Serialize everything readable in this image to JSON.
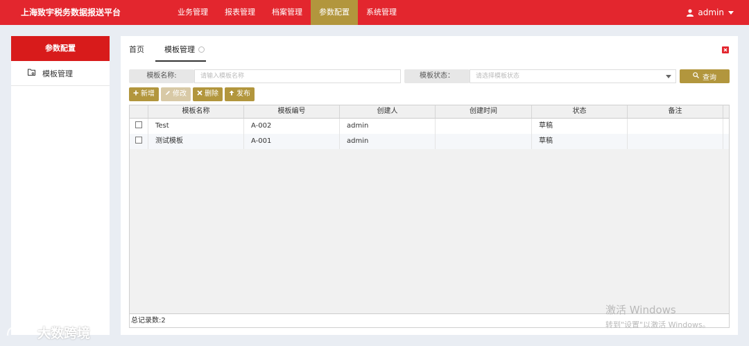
{
  "header": {
    "brand": "上海致宇税务数据报送平台",
    "nav": [
      "业务管理",
      "报表管理",
      "档案管理",
      "参数配置",
      "系统管理"
    ],
    "active_nav": "参数配置",
    "user": "admin"
  },
  "sidebar": {
    "title": "参数配置",
    "items": [
      {
        "label": "模板管理",
        "icon": "folder-icon"
      }
    ]
  },
  "tabs": [
    {
      "label": "首页"
    },
    {
      "label": "模板管理",
      "active": true
    }
  ],
  "search": {
    "name_label": "模板名称:",
    "name_placeholder": "请输入模板名称",
    "status_label": "模板状态：",
    "status_placeholder": "请选择模板状态",
    "button": "查询"
  },
  "toolbar": {
    "add": "新增",
    "edit": "修改",
    "delete": "删除",
    "publish": "发布"
  },
  "table": {
    "columns": [
      "模板名称",
      "模板编号",
      "创建人",
      "创建时间",
      "状态",
      "备注"
    ],
    "rows": [
      [
        "Test",
        "A-002",
        "admin",
        "",
        "草稿",
        ""
      ],
      [
        "测试模板",
        "A-001",
        "admin",
        "",
        "草稿",
        ""
      ]
    ],
    "footer": "总记录数:2"
  },
  "watermark": {
    "windows_line1": "激活 Windows",
    "windows_line2": "转到\"设置\"以激活 Windows。",
    "logo": "大数跨境"
  },
  "colors": {
    "header": "#e3262e",
    "accent": "#b2963d",
    "sidebar_header": "#d81b1b"
  }
}
